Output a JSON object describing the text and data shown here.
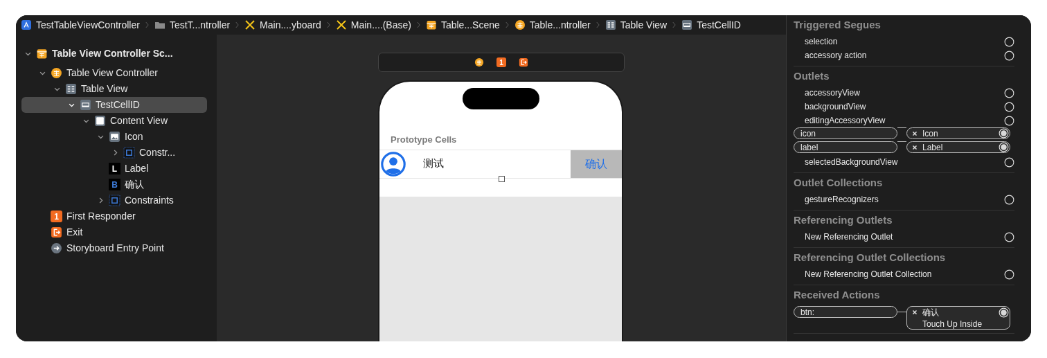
{
  "breadcrumbs": [
    {
      "kind": "project",
      "label": "TestTableViewController"
    },
    {
      "kind": "folder",
      "label": "TestT...ntroller"
    },
    {
      "kind": "storyboard",
      "label": "Main....yboard"
    },
    {
      "kind": "storyboard",
      "label": "Main....(Base)"
    },
    {
      "kind": "scene",
      "label": "Table...Scene"
    },
    {
      "kind": "controller",
      "label": "Table...ntroller"
    },
    {
      "kind": "tableview",
      "label": "Table View"
    },
    {
      "kind": "cell",
      "label": "TestCellID"
    }
  ],
  "outline": [
    {
      "kind": "scene",
      "label": "Table View Controller Sc...",
      "bold": true,
      "expanded": true,
      "selected": false,
      "children": [
        {
          "kind": "controller",
          "label": "Table View Controller",
          "expanded": true,
          "selected": false,
          "children": [
            {
              "kind": "tableview",
              "label": "Table View",
              "expanded": true,
              "selected": false,
              "children": [
                {
                  "kind": "cell",
                  "label": "TestCellID",
                  "expanded": true,
                  "selected": true,
                  "children": [
                    {
                      "kind": "view",
                      "label": "Content View",
                      "expanded": true,
                      "selected": false,
                      "children": [
                        {
                          "kind": "image",
                          "label": "Icon",
                          "expanded": true,
                          "selected": false,
                          "children": [
                            {
                              "kind": "constraints",
                              "label": "Constr...",
                              "expanded": false,
                              "selected": false
                            }
                          ]
                        },
                        {
                          "kind": "label",
                          "badge": "L",
                          "label": "Label",
                          "selected": false
                        },
                        {
                          "kind": "button",
                          "badge": "B",
                          "label": "确认",
                          "selected": false
                        },
                        {
                          "kind": "constraints",
                          "label": "Constraints",
                          "expanded": false,
                          "selected": false
                        }
                      ]
                    }
                  ]
                }
              ]
            }
          ]
        },
        {
          "kind": "responder",
          "badge": "1",
          "label": "First Responder",
          "selected": false
        },
        {
          "kind": "exit",
          "label": "Exit",
          "selected": false
        },
        {
          "kind": "entry",
          "label": "Storyboard Entry Point",
          "selected": false
        }
      ]
    }
  ],
  "canvas": {
    "dock": [
      {
        "kind": "controller"
      },
      {
        "kind": "responder",
        "badge": "1"
      },
      {
        "kind": "exit"
      }
    ],
    "section_header": "Prototype Cells",
    "cell_label": "测试",
    "cell_button": "确认"
  },
  "connections": [
    {
      "title": "Triggered Segues",
      "rows": [
        {
          "name": "selection",
          "connected": false
        },
        {
          "name": "accessory action",
          "connected": false
        }
      ]
    },
    {
      "title": "Outlets",
      "rows": [
        {
          "name": "accessoryView",
          "connected": false
        },
        {
          "name": "backgroundView",
          "connected": false
        },
        {
          "name": "editingAccessoryView",
          "connected": false
        },
        {
          "name": "icon",
          "connected": true,
          "target": "Icon"
        },
        {
          "name": "label",
          "connected": true,
          "target": "Label"
        },
        {
          "name": "selectedBackgroundView",
          "connected": false
        }
      ]
    },
    {
      "title": "Outlet Collections",
      "rows": [
        {
          "name": "gestureRecognizers",
          "connected": false
        }
      ]
    },
    {
      "title": "Referencing Outlets",
      "rows": [
        {
          "name": "New Referencing Outlet",
          "connected": false
        }
      ]
    },
    {
      "title": "Referencing Outlet Collections",
      "rows": [
        {
          "name": "New Referencing Outlet Collection",
          "connected": false
        }
      ]
    },
    {
      "title": "Received Actions",
      "rows": [
        {
          "name": "btn:",
          "connected": true,
          "target": "确认",
          "event": "Touch Up Inside"
        }
      ]
    }
  ]
}
